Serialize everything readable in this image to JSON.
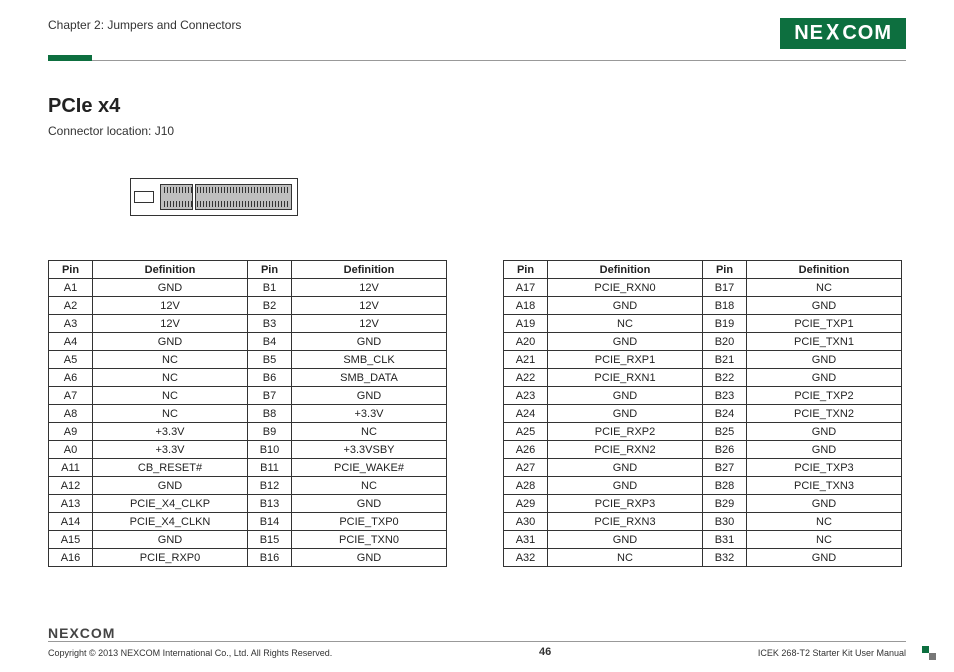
{
  "header": {
    "chapter": "Chapter 2: Jumpers and Connectors",
    "logo_text_1": "NE",
    "logo_text_x": "X",
    "logo_text_2": "COM"
  },
  "section": {
    "title": "PCIe x4",
    "subtitle": "Connector location: J10"
  },
  "table_headers": {
    "pin": "Pin",
    "definition": "Definition"
  },
  "table_left": [
    {
      "pa": "A1",
      "da": "GND",
      "pb": "B1",
      "db": "12V"
    },
    {
      "pa": "A2",
      "da": "12V",
      "pb": "B2",
      "db": "12V"
    },
    {
      "pa": "A3",
      "da": "12V",
      "pb": "B3",
      "db": "12V"
    },
    {
      "pa": "A4",
      "da": "GND",
      "pb": "B4",
      "db": "GND"
    },
    {
      "pa": "A5",
      "da": "NC",
      "pb": "B5",
      "db": "SMB_CLK"
    },
    {
      "pa": "A6",
      "da": "NC",
      "pb": "B6",
      "db": "SMB_DATA"
    },
    {
      "pa": "A7",
      "da": "NC",
      "pb": "B7",
      "db": "GND"
    },
    {
      "pa": "A8",
      "da": "NC",
      "pb": "B8",
      "db": "+3.3V"
    },
    {
      "pa": "A9",
      "da": "+3.3V",
      "pb": "B9",
      "db": "NC"
    },
    {
      "pa": "A0",
      "da": "+3.3V",
      "pb": "B10",
      "db": "+3.3VSBY"
    },
    {
      "pa": "A11",
      "da": "CB_RESET#",
      "pb": "B11",
      "db": "PCIE_WAKE#"
    },
    {
      "pa": "A12",
      "da": "GND",
      "pb": "B12",
      "db": "NC"
    },
    {
      "pa": "A13",
      "da": "PCIE_X4_CLKP",
      "pb": "B13",
      "db": "GND"
    },
    {
      "pa": "A14",
      "da": "PCIE_X4_CLKN",
      "pb": "B14",
      "db": "PCIE_TXP0"
    },
    {
      "pa": "A15",
      "da": "GND",
      "pb": "B15",
      "db": "PCIE_TXN0"
    },
    {
      "pa": "A16",
      "da": "PCIE_RXP0",
      "pb": "B16",
      "db": "GND"
    }
  ],
  "table_right": [
    {
      "pa": "A17",
      "da": "PCIE_RXN0",
      "pb": "B17",
      "db": "NC"
    },
    {
      "pa": "A18",
      "da": "GND",
      "pb": "B18",
      "db": "GND"
    },
    {
      "pa": "A19",
      "da": "NC",
      "pb": "B19",
      "db": "PCIE_TXP1"
    },
    {
      "pa": "A20",
      "da": "GND",
      "pb": "B20",
      "db": "PCIE_TXN1"
    },
    {
      "pa": "A21",
      "da": "PCIE_RXP1",
      "pb": "B21",
      "db": "GND"
    },
    {
      "pa": "A22",
      "da": "PCIE_RXN1",
      "pb": "B22",
      "db": "GND"
    },
    {
      "pa": "A23",
      "da": "GND",
      "pb": "B23",
      "db": "PCIE_TXP2"
    },
    {
      "pa": "A24",
      "da": "GND",
      "pb": "B24",
      "db": "PCIE_TXN2"
    },
    {
      "pa": "A25",
      "da": "PCIE_RXP2",
      "pb": "B25",
      "db": "GND"
    },
    {
      "pa": "A26",
      "da": "PCIE_RXN2",
      "pb": "B26",
      "db": "GND"
    },
    {
      "pa": "A27",
      "da": "GND",
      "pb": "B27",
      "db": "PCIE_TXP3"
    },
    {
      "pa": "A28",
      "da": "GND",
      "pb": "B28",
      "db": "PCIE_TXN3"
    },
    {
      "pa": "A29",
      "da": "PCIE_RXP3",
      "pb": "B29",
      "db": "GND"
    },
    {
      "pa": "A30",
      "da": "PCIE_RXN3",
      "pb": "B30",
      "db": "NC"
    },
    {
      "pa": "A31",
      "da": "GND",
      "pb": "B31",
      "db": "NC"
    },
    {
      "pa": "A32",
      "da": "NC",
      "pb": "B32",
      "db": "GND"
    }
  ],
  "footer": {
    "logo": "NEXCOM",
    "copyright": "Copyright © 2013 NEXCOM International Co., Ltd. All Rights Reserved.",
    "page_number": "46",
    "doc_title": "ICEK 268-T2 Starter Kit User Manual"
  }
}
